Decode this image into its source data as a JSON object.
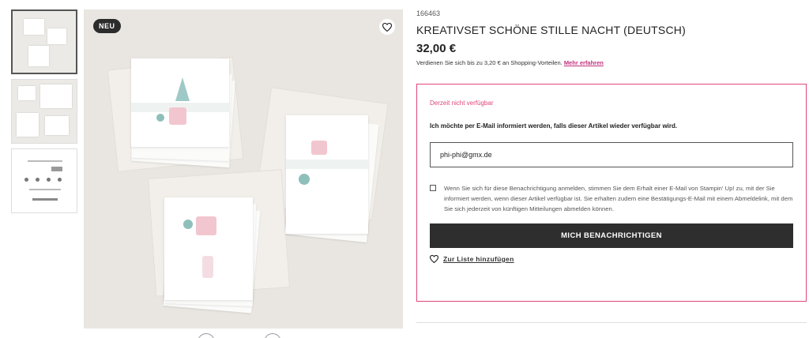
{
  "main_image": {
    "badge": "NEU",
    "favorite_icon": "heart-outline-icon"
  },
  "thumbnails": [
    {
      "name": "thumbnail-1",
      "active": true
    },
    {
      "name": "thumbnail-2",
      "active": false
    },
    {
      "name": "thumbnail-3",
      "active": false
    }
  ],
  "product": {
    "sku": "166463",
    "title": "KREATIVSET SCHÖNE STILLE NACHT (DEUTSCH)",
    "price": "32,00 €",
    "benefit_text": "Verdienen Sie sich bis zu 3,20 € an Shopping-Vorteilen.",
    "benefit_link": "Mehr erfahren"
  },
  "notify": {
    "status": "Derzeit nicht verfügbar",
    "question": "Ich möchte per E-Mail informiert werden, falls dieser Artikel wieder verfügbar wird.",
    "email_value": "phi-phi@gmx.de",
    "consent_text": "Wenn Sie sich für diese Benachrichtigung anmelden, stimmen Sie dem Erhalt einer E-Mail von Stampin' Up! zu, mit der Sie informiert werden, wenn dieser Artikel verfügbar ist. Sie erhalten zudem eine Bestätigungs-E-Mail mit einem Abmeldelink, mit dem Sie sich jederzeit von künftigen Mitteilungen abmelden können.",
    "button_label": "MICH BENACHRICHTIGEN",
    "wishlist_label": "Zur Liste hinzufügen"
  },
  "colors": {
    "accent": "#e0457b",
    "link": "#c0307c",
    "button": "#2e2e2e"
  }
}
